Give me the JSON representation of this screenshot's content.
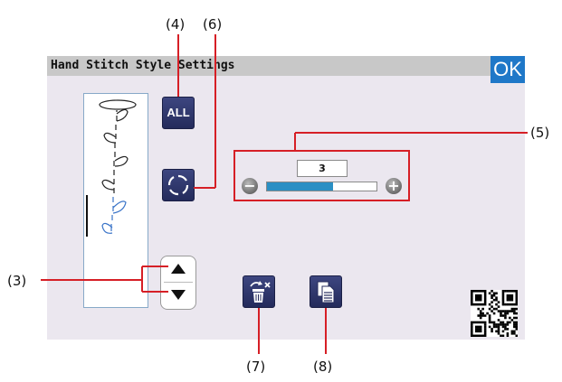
{
  "window": {
    "title": "Hand Stitch Style Settings",
    "ok_label": "OK"
  },
  "buttons": {
    "all_label": "ALL",
    "minus_label": "−",
    "plus_label": "+"
  },
  "stitch_length": {
    "value": "3",
    "fill_fraction": 0.6
  },
  "callouts": {
    "c3": "(3)",
    "c4": "(4)",
    "c5": "(5)",
    "c6": "(6)",
    "c7": "(7)",
    "c8": "(8)"
  },
  "colors": {
    "accent": "#1f78c8",
    "callout_line": "#d61f26",
    "button_dark": "#2b3266",
    "slider_fill": "#2a8fc4"
  },
  "icons": [
    "refresh-ring-icon",
    "up-arrow-icon",
    "down-arrow-icon",
    "delete-icon",
    "copy-icon",
    "qr-code-icon"
  ]
}
